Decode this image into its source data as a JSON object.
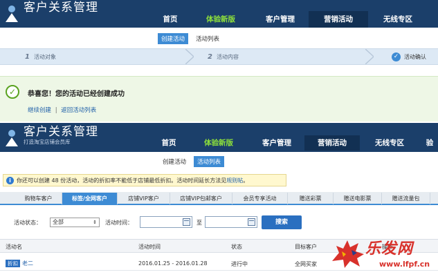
{
  "header1": {
    "title": "客户关系管理",
    "nav": [
      "首页",
      "体验新版",
      "客户管理",
      "营销活动",
      "无线专区"
    ],
    "subnav": [
      "创建活动",
      "活动列表"
    ]
  },
  "steps": [
    "活动对象",
    "活动内容",
    "活动确认"
  ],
  "step_numbers": [
    "1",
    "2"
  ],
  "success": {
    "title": "恭喜您！您的活动已经创建成功",
    "link_continue": "继续创建",
    "separator": "|",
    "link_back": "返回活动列表"
  },
  "header2": {
    "title": "客户关系管理",
    "subtitle": "打造淘宝店铺会员库",
    "nav": [
      "首页",
      "体验新版",
      "客户管理",
      "营销活动",
      "无线专区",
      "验"
    ],
    "subnav": [
      "创建活动",
      "活动列表"
    ]
  },
  "notice": {
    "text": "你还可以创建 48 份活动，活动的折扣率不能低于店铺最低折扣。活动时间延长方法见",
    "link": "规则帖",
    "end": "。"
  },
  "tabs": [
    "购物车客户",
    "标签/全网客户",
    "店铺VIP客户",
    "店铺VIP包邮客户",
    "会员专享活动",
    "赠送彩票",
    "赠送电影票",
    "赠送流量包"
  ],
  "filter": {
    "status_label": "活动状态：",
    "status_value": "全部",
    "time_label": "活动时间：",
    "to": "至",
    "search": "搜索"
  },
  "table": {
    "headers": [
      "活动名",
      "活动时间",
      "状态",
      "目标客户",
      "操作"
    ],
    "row": {
      "tag": "折扣",
      "name": "老二",
      "time": "2016.01.25 - 2016.01.28",
      "status": "进行中",
      "target": "全网买家"
    }
  },
  "watermark": {
    "text": "乐发网",
    "url": "www.lfpf.cn"
  },
  "colors": {
    "header_bg": "#1b3f6a",
    "accent": "#3d8bd4",
    "green_nav": "#8fe23a",
    "success_green": "#5aa320"
  }
}
